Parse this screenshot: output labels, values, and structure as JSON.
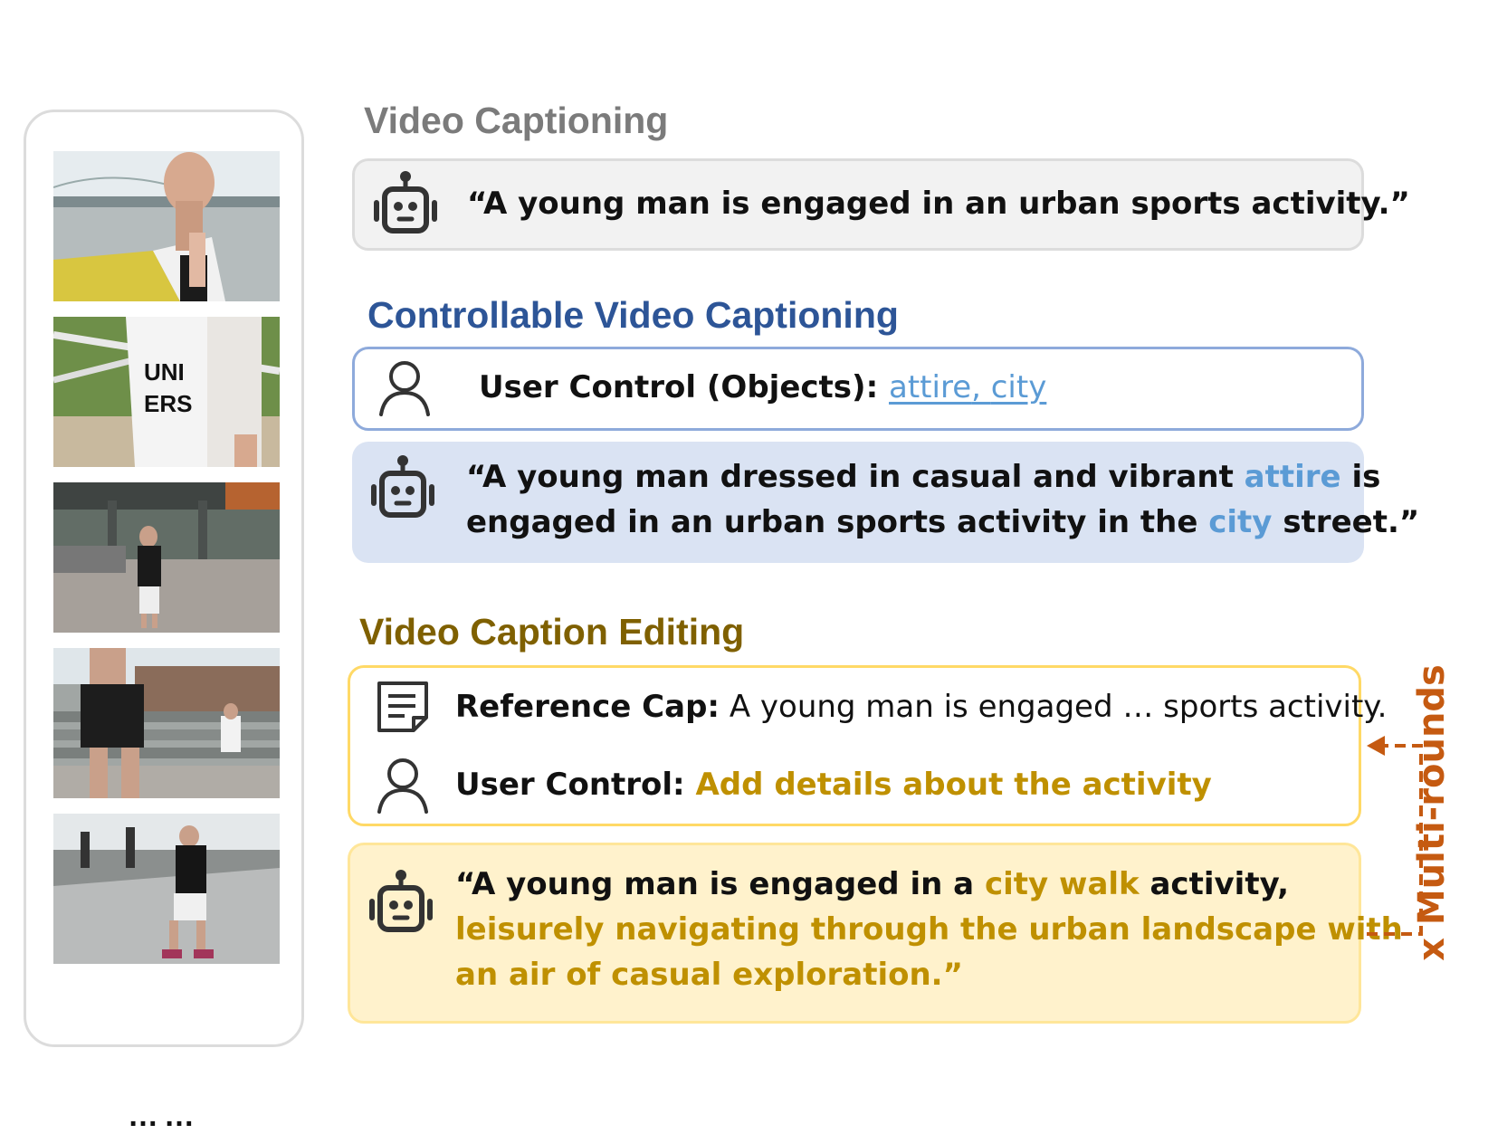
{
  "sections": {
    "video_captioning": {
      "title": "Video Captioning",
      "caption": "“A young man is engaged in an urban sports activity.”"
    },
    "controllable": {
      "title": "Controllable Video Captioning",
      "control_label": "User Control (Objects): ",
      "control_obj1": "attire",
      "control_sep": ", ",
      "control_obj2": "city",
      "caption": {
        "l1_a": "“A young man dressed in casual and vibrant ",
        "l1_hl": "attire",
        "l1_b": " is",
        "l2_a": "engaged in an urban sports activity in the ",
        "l2_hl": "city",
        "l2_b": " street.”"
      }
    },
    "editing": {
      "title": "Video Caption Editing",
      "ref_label": "Reference Cap:",
      "ref_text": " A young man is engaged  … sports activity.",
      "control_label": "User Control:",
      "control_text": " Add details about the activity",
      "caption": {
        "l1_a": "“A young man is engaged in a ",
        "l1_hl": "city walk",
        "l1_b": " activity,",
        "l2": "leisurely navigating through the urban landscape with",
        "l3": "an air of casual exploration.”"
      },
      "multi_rounds": "x Multi-rounds"
    }
  },
  "frames": {
    "ellipsis": "……"
  },
  "colors": {
    "blue_title": "#2d5597",
    "gold_title": "#7f6000",
    "gold_text": "#bf9000",
    "highlight_blue": "#5b9bd5",
    "orange": "#c55a11"
  },
  "icons": [
    "robot-icon",
    "user-icon",
    "document-icon"
  ]
}
